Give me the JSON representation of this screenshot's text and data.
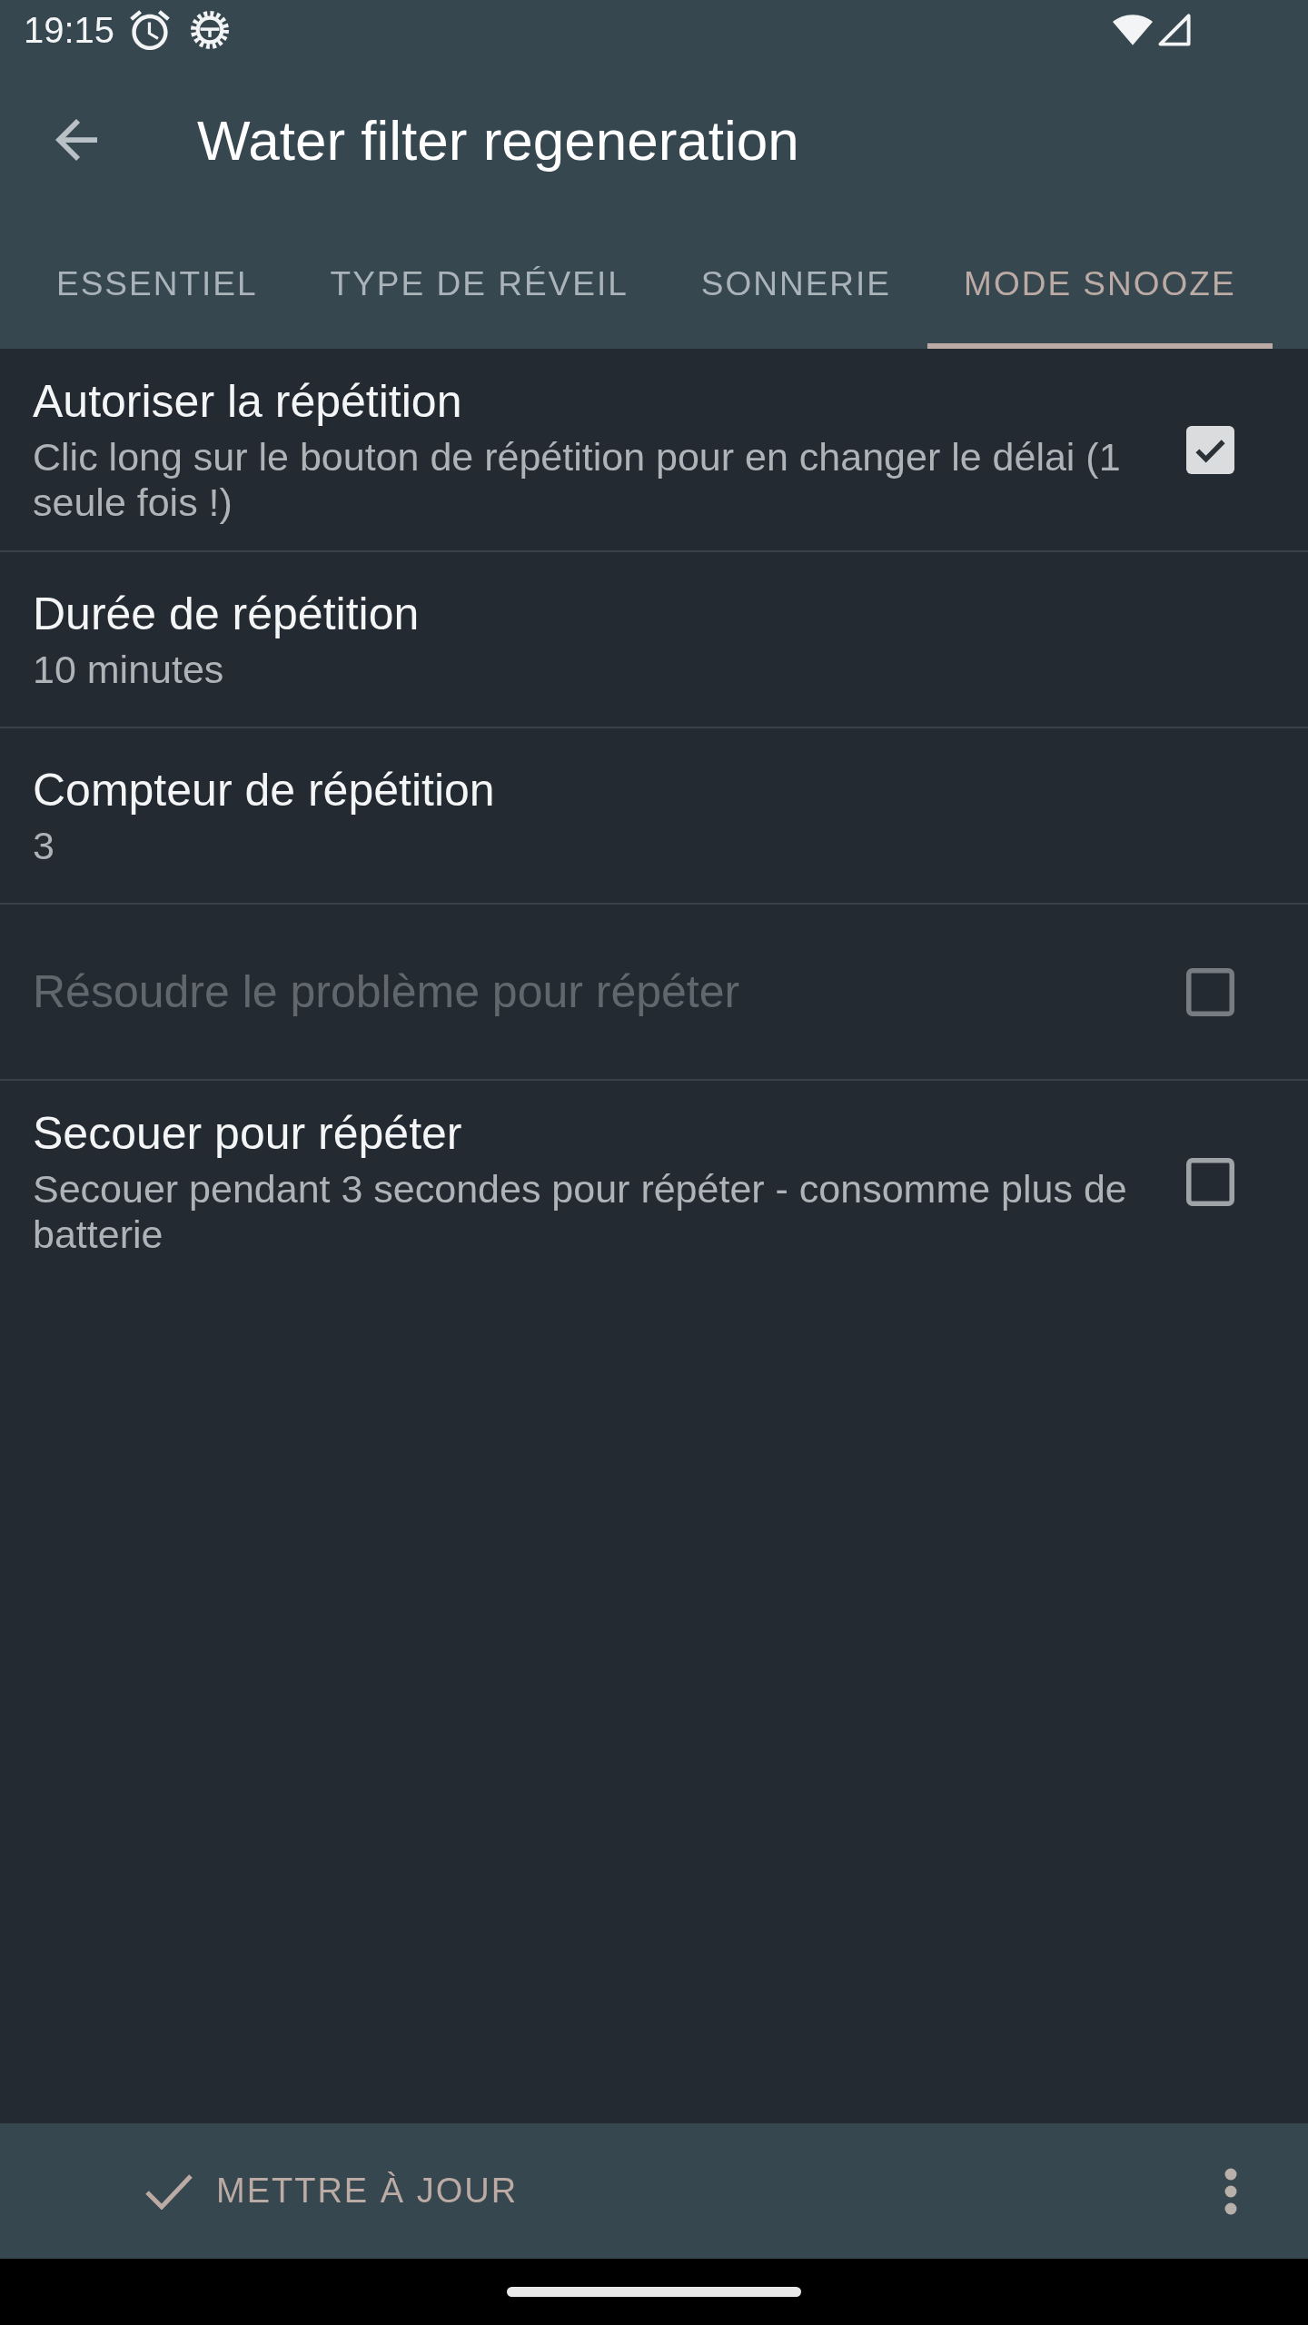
{
  "status_bar": {
    "time": "19:15"
  },
  "app_bar": {
    "title": "Water filter regeneration"
  },
  "tabs": [
    {
      "label": "ESSENTIEL",
      "selected": false
    },
    {
      "label": "TYPE DE RÉVEIL",
      "selected": false
    },
    {
      "label": "SONNERIE",
      "selected": false
    },
    {
      "label": "MODE SNOOZE",
      "selected": true
    }
  ],
  "preferences": [
    {
      "kind": "checkbox",
      "title": "Autoriser la répétition",
      "summary": "Clic long sur le bouton de répétition pour en changer le délai (1 seule fois !)",
      "checked": true,
      "disabled": false
    },
    {
      "kind": "value",
      "title": "Durée de répétition",
      "summary": "10 minutes",
      "disabled": false
    },
    {
      "kind": "value",
      "title": "Compteur de répétition",
      "summary": "3",
      "disabled": false
    },
    {
      "kind": "checkbox",
      "title": "Résoudre le problème pour répéter",
      "checked": false,
      "disabled": true
    },
    {
      "kind": "checkbox",
      "title": "Secouer pour répéter",
      "summary": "Secouer pendant 3 secondes pour répéter - consomme plus de batterie",
      "checked": false,
      "disabled": false
    }
  ],
  "bottom_bar": {
    "action": "METTRE À JOUR"
  }
}
